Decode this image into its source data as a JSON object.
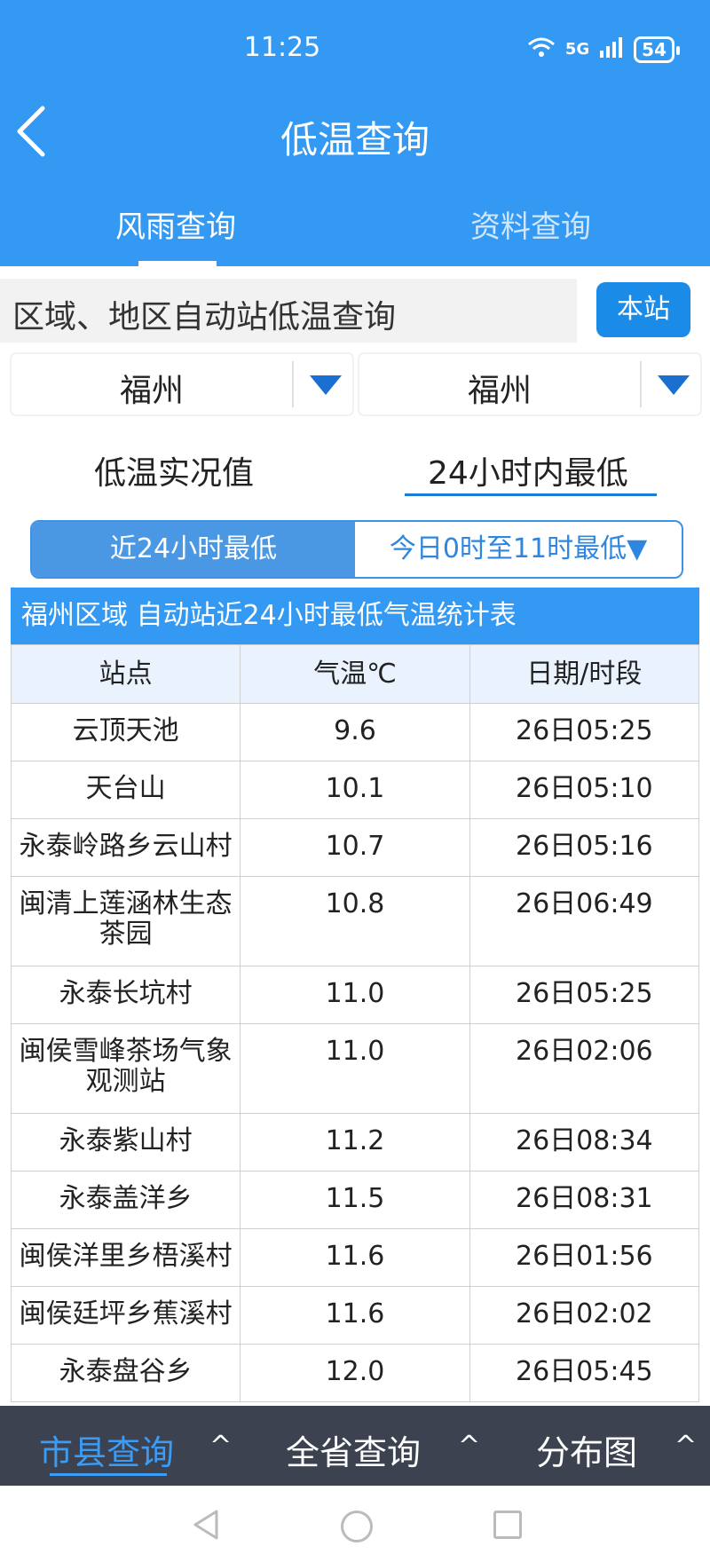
{
  "status_bar": {
    "time": "11:25",
    "battery": "54",
    "signal_label": "5G",
    "wifi_label": "6"
  },
  "header": {
    "title": "低温查询"
  },
  "tabs": [
    {
      "label": "风雨查询"
    },
    {
      "label": "资料查询"
    }
  ],
  "search": {
    "label": "区域、地区自动站低温查询",
    "local_button": "本站"
  },
  "selectors": {
    "region": "福州",
    "area": "福州"
  },
  "modes": {
    "current": "低温实况值",
    "min24": "24小时内最低"
  },
  "segment": {
    "left": "近24小时最低",
    "right": "今日0时至11时最低▼"
  },
  "table": {
    "title": "福州区域 自动站近24小时最低气温统计表",
    "headers": [
      "站点",
      "气温℃",
      "日期/时段"
    ],
    "rows": [
      {
        "station": "云顶天池",
        "temp": "9.6",
        "time": "26日05:25"
      },
      {
        "station": "天台山",
        "temp": "10.1",
        "time": "26日05:10"
      },
      {
        "station": "永泰岭路乡云山村",
        "temp": "10.7",
        "time": "26日05:16"
      },
      {
        "station": "闽清上莲涵林生态茶园",
        "temp": "10.8",
        "time": "26日06:49"
      },
      {
        "station": "永泰长坑村",
        "temp": "11.0",
        "time": "26日05:25"
      },
      {
        "station": "闽侯雪峰茶场气象观测站",
        "temp": "11.0",
        "time": "26日02:06"
      },
      {
        "station": "永泰紫山村",
        "temp": "11.2",
        "time": "26日08:34"
      },
      {
        "station": "永泰盖洋乡",
        "temp": "11.5",
        "time": "26日08:31"
      },
      {
        "station": "闽侯洋里乡梧溪村",
        "temp": "11.6",
        "time": "26日01:56"
      },
      {
        "station": "闽侯廷坪乡蕉溪村",
        "temp": "11.6",
        "time": "26日02:02"
      },
      {
        "station": "永泰盘谷乡",
        "temp": "12.0",
        "time": "26日05:45"
      }
    ]
  },
  "bottom_nav": [
    {
      "label": "市县查询"
    },
    {
      "label": "全省查询"
    },
    {
      "label": "分布图"
    }
  ],
  "colors": {
    "primary": "#3399f3",
    "dark_bar": "#3c4250",
    "accent_text": "#3b9cf6"
  }
}
